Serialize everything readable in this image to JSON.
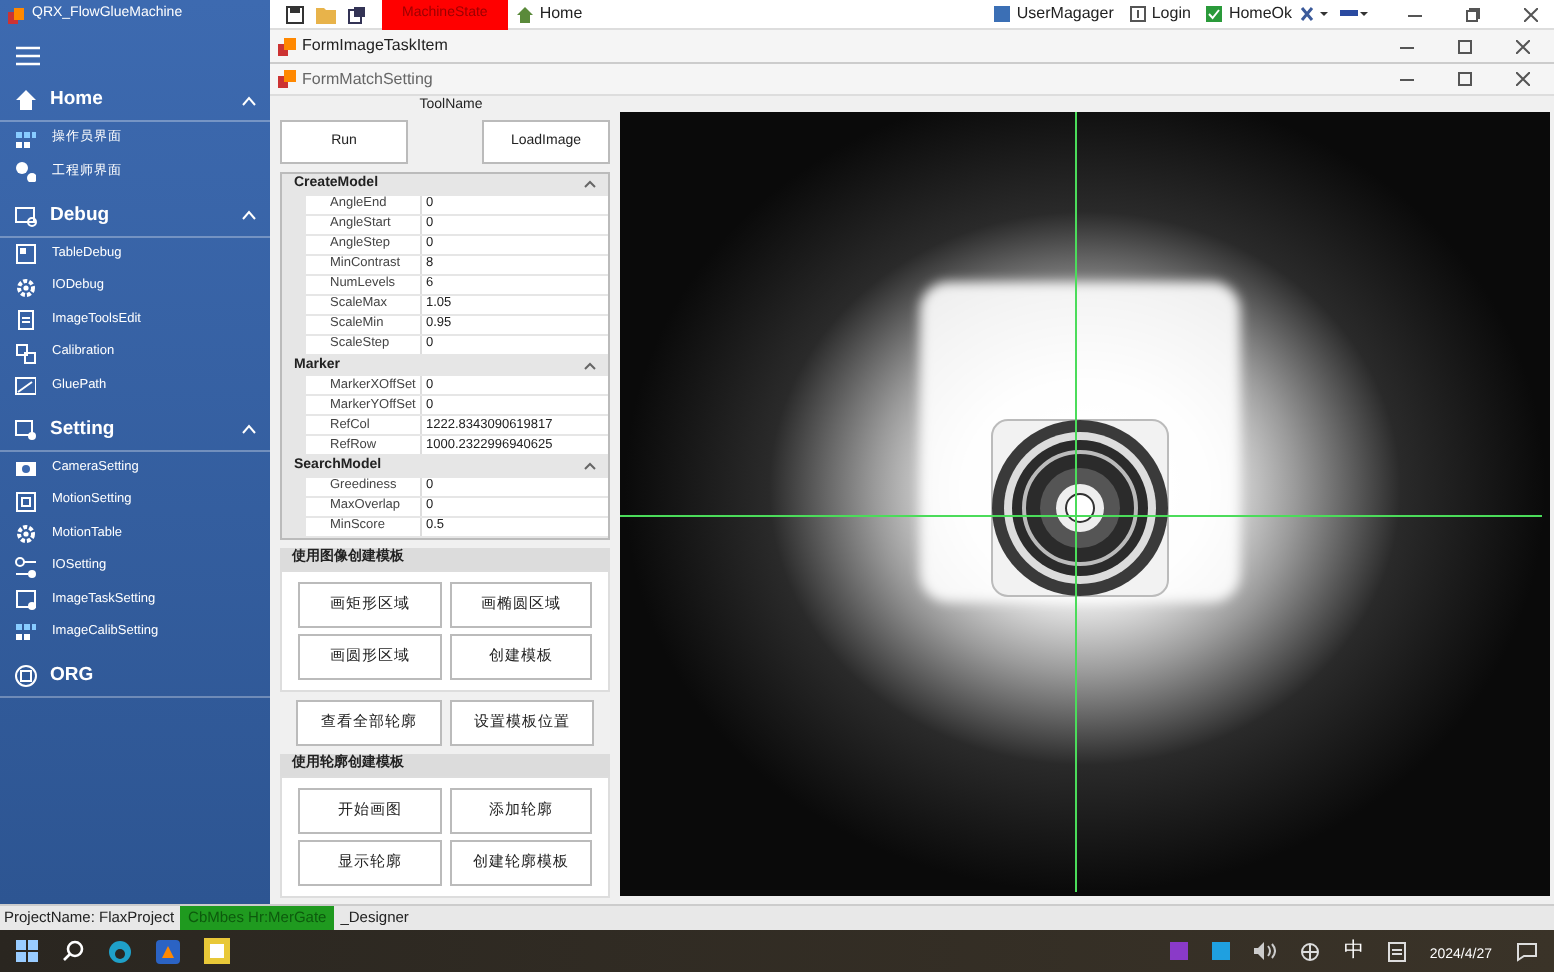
{
  "app": {
    "title": "QRX_FlowGlueMachine"
  },
  "toolbar": {
    "machine_state": "MachineState",
    "home": "Home",
    "user_manager": "UserMagager",
    "login": "Login",
    "home_ok": "HomeOk"
  },
  "sidebar": [
    {
      "label": "Home",
      "expanded": true,
      "items": [
        {
          "label": "操作员界面"
        },
        {
          "label": "工程师界面"
        }
      ]
    },
    {
      "label": "Debug",
      "expanded": true,
      "items": [
        {
          "label": "TableDebug"
        },
        {
          "label": "IODebug"
        },
        {
          "label": "ImageToolsEdit"
        },
        {
          "label": "Calibration"
        },
        {
          "label": "GluePath"
        }
      ]
    },
    {
      "label": "Setting",
      "expanded": true,
      "items": [
        {
          "label": "CameraSetting"
        },
        {
          "label": "MotionSetting"
        },
        {
          "label": "MotionTable"
        },
        {
          "label": "IOSetting"
        },
        {
          "label": "ImageTaskSetting"
        },
        {
          "label": "ImageCalibSetting"
        }
      ]
    },
    {
      "label": "ORG"
    }
  ],
  "tab": {
    "title": "FormImageTaskItem"
  },
  "child_window": {
    "title": "FormMatchSetting"
  },
  "tool_name": "ToolName",
  "buttons": [
    "Run",
    "LoadImage"
  ],
  "property_grid": [
    {
      "category": "CreateModel",
      "expanded": true,
      "rows": [
        [
          "AngleEnd",
          "0"
        ],
        [
          "AngleStart",
          "0"
        ],
        [
          "AngleStep",
          "0"
        ],
        [
          "MinContrast",
          "8"
        ],
        [
          "NumLevels",
          "6"
        ],
        [
          "ScaleMax",
          "1.05"
        ],
        [
          "ScaleMin",
          "0.95"
        ],
        [
          "ScaleStep",
          "0"
        ]
      ]
    },
    {
      "category": "Marker",
      "expanded": true,
      "rows": [
        [
          "MarkerXOffSet",
          "0"
        ],
        [
          "MarkerYOffSet",
          "0"
        ],
        [
          "RefCol",
          "1222.8343090619817"
        ],
        [
          "RefRow",
          "1000.2322996940625"
        ]
      ]
    },
    {
      "category": "SearchModel",
      "expanded": true,
      "rows": [
        [
          "Greediness",
          "0"
        ],
        [
          "MaxOverlap",
          "0"
        ],
        [
          "MinScore",
          "0.5"
        ]
      ]
    }
  ],
  "groups": [
    {
      "title": "使用图像创建模板",
      "buttons": [
        "画矩形区域",
        "画椭圆区域",
        "画圆形区域",
        "创建模板"
      ],
      "extra_buttons": [
        "查看全部轮廓",
        "设置模板位置"
      ]
    },
    {
      "title": "使用轮廓创建模板",
      "buttons": [
        "开始画图",
        "添加轮廓",
        "显示轮廓",
        "创建轮廓模板"
      ]
    }
  ],
  "status_bar": {
    "project": "ProjectName: FlaxProject",
    "status": "CbMbes  Hr:MerGate",
    "mode": "_Designer"
  },
  "taskbar": {
    "ime": "中",
    "date": "2024/4/27"
  }
}
